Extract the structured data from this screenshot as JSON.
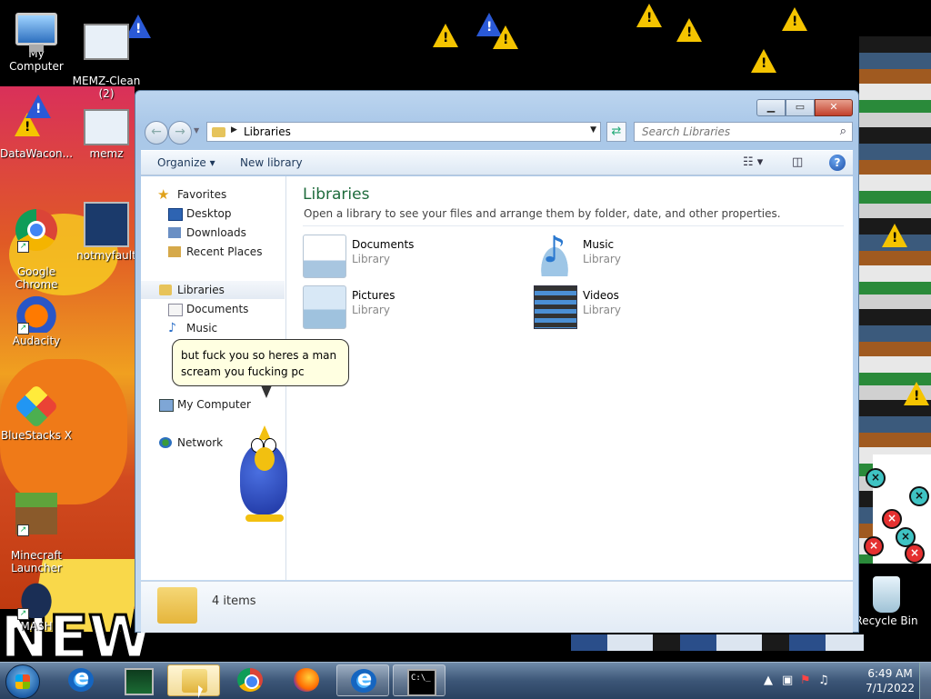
{
  "desktop": {
    "icons": {
      "my_computer": "My Computer",
      "memz_clean": "MEMZ-Clean\n(2)",
      "datawatcher": "DataWacon...",
      "memz": "memz",
      "chrome": "Google\nChrome",
      "notmyfault": "notmyfault",
      "audacity": "Audacity",
      "bluestacks": "BlueStacks X",
      "minecraft": "Minecraft\nLauncher",
      "mash": "MASH",
      "recycle_bin": "Recycle Bin"
    },
    "art_text": "NEW"
  },
  "explorer": {
    "address": "Libraries",
    "search_placeholder": "Search Libraries",
    "toolbar": {
      "organize": "Organize",
      "new_library": "New library"
    },
    "nav": {
      "favorites": "Favorites",
      "desktop": "Desktop",
      "downloads": "Downloads",
      "recent_places": "Recent Places",
      "libraries": "Libraries",
      "documents": "Documents",
      "music": "Music",
      "my_computer": "My Computer",
      "network": "Network"
    },
    "content": {
      "title": "Libraries",
      "subtitle": "Open a library to see your files and arrange them by folder, date, and other properties.",
      "libraries": [
        {
          "name": "Documents",
          "type": "Library",
          "icon": "documents-library-icon"
        },
        {
          "name": "Music",
          "type": "Library",
          "icon": "music-library-icon"
        },
        {
          "name": "Pictures",
          "type": "Library",
          "icon": "pictures-library-icon"
        },
        {
          "name": "Videos",
          "type": "Library",
          "icon": "videos-library-icon"
        }
      ]
    },
    "details": {
      "count": "4 items"
    }
  },
  "agent": {
    "line1": "but fuck you so heres a man",
    "line2": "scream you fucking pc"
  },
  "taskbar": {
    "time": "6:49 AM",
    "date": "7/1/2022"
  },
  "colors": {
    "accent": "#1e6b3c",
    "titlebar": "#bcd5ef",
    "warning": "#f5c400"
  }
}
